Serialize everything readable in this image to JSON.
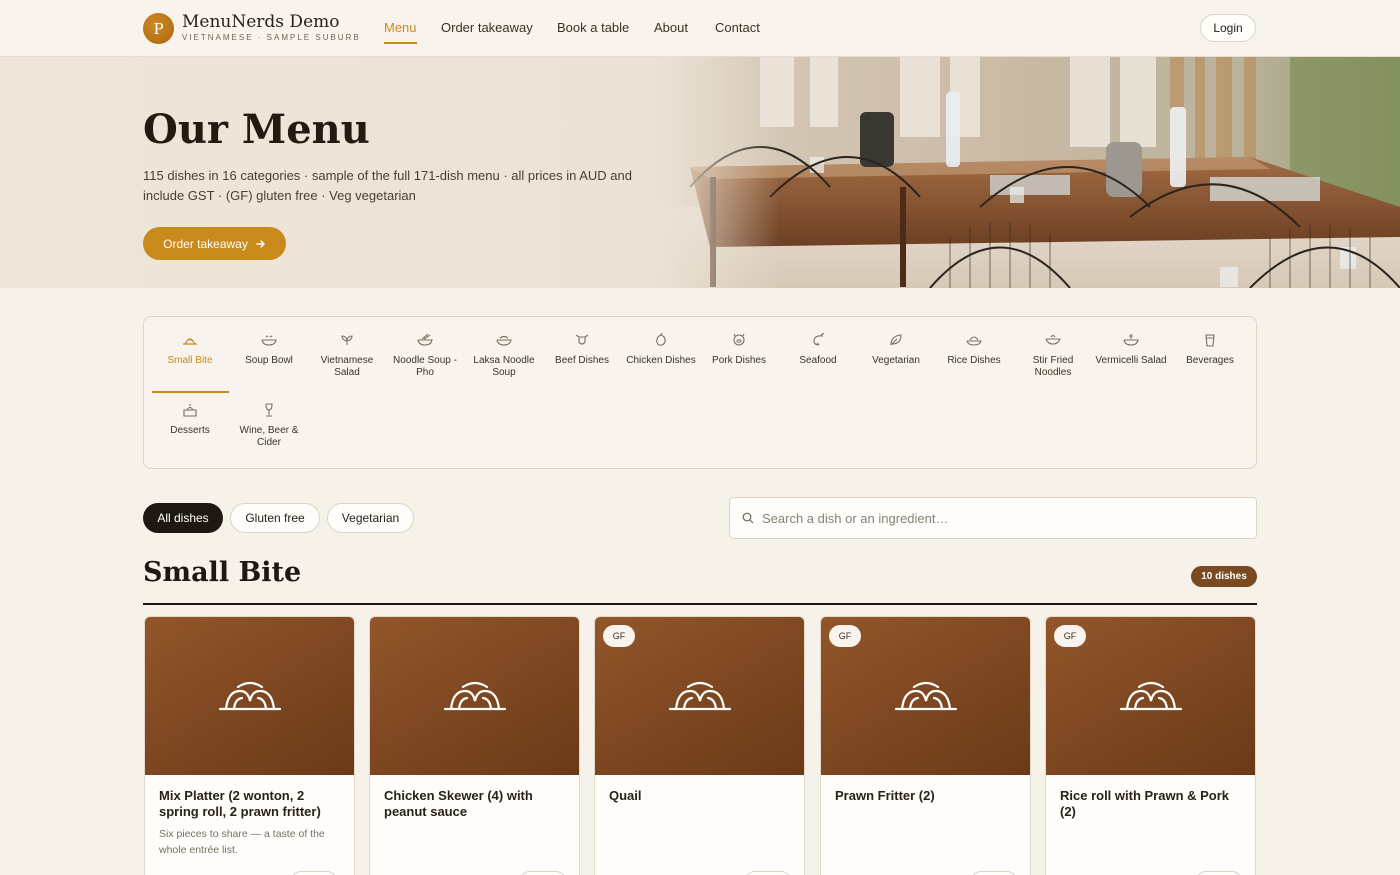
{
  "brand": {
    "logo_letter": "P",
    "name": "MenuNerds Demo",
    "subtitle": "VIETNAMESE · SAMPLE SUBURB"
  },
  "nav": {
    "items": [
      {
        "label": "Menu",
        "active": true
      },
      {
        "label": "Order takeaway"
      },
      {
        "label": "Book a table"
      },
      {
        "label": "About"
      },
      {
        "label": "Contact"
      }
    ],
    "login_label": "Login"
  },
  "hero": {
    "title": "Our Menu",
    "description": "115 dishes in 16 categories · sample of the full 171-dish menu · all prices in AUD and include GST · (GF) gluten free · Veg vegetarian",
    "cta_label": "Order takeaway",
    "cta_icon": "arrow-right-icon"
  },
  "categories": [
    {
      "label": "Small Bite",
      "icon": "platter-icon",
      "active": true
    },
    {
      "label": "Soup Bowl",
      "icon": "bowl-icon"
    },
    {
      "label": "Vietnamese Salad",
      "icon": "leaf-icon"
    },
    {
      "label": "Noodle Soup - Pho",
      "icon": "noodle-bowl-icon"
    },
    {
      "label": "Laksa Noodle Soup",
      "icon": "laksa-bowl-icon"
    },
    {
      "label": "Beef Dishes",
      "icon": "cow-icon"
    },
    {
      "label": "Chicken Dishes",
      "icon": "chicken-icon"
    },
    {
      "label": "Pork Dishes",
      "icon": "pig-icon"
    },
    {
      "label": "Seafood",
      "icon": "shrimp-icon"
    },
    {
      "label": "Vegetarian",
      "icon": "veg-leaf-icon"
    },
    {
      "label": "Rice Dishes",
      "icon": "rice-bowl-icon"
    },
    {
      "label": "Stir Fried Noodles",
      "icon": "wok-icon"
    },
    {
      "label": "Vermicelli Salad",
      "icon": "vermicelli-icon"
    },
    {
      "label": "Beverages",
      "icon": "cup-icon"
    },
    {
      "label": "Desserts",
      "icon": "cake-icon"
    },
    {
      "label": "Wine, Beer & Cider",
      "icon": "wine-glass-icon"
    }
  ],
  "filters": {
    "all": "All dishes",
    "gluten_free": "Gluten free",
    "vegetarian": "Vegetarian"
  },
  "search": {
    "placeholder": "Search a dish or an ingredient…",
    "value": ""
  },
  "section": {
    "title": "Small Bite",
    "count": "10 dishes"
  },
  "dishes": [
    {
      "name": "Mix Platter (2 wonton, 2 spring roll, 2 prawn fritter)",
      "desc": "Six pieces to share — a taste of the whole entrée list.",
      "badge": "",
      "icon": "dish-cloche-icon"
    },
    {
      "name": "Chicken Skewer (4) with peanut sauce",
      "desc": "",
      "badge": "",
      "icon": "dish-cloche-icon"
    },
    {
      "name": "Quail",
      "desc": "",
      "badge": "GF",
      "icon": "dish-cloche-icon"
    },
    {
      "name": "Prawn Fritter (2)",
      "desc": "",
      "badge": "GF",
      "icon": "dish-cloche-icon"
    },
    {
      "name": "Rice roll with Prawn & Pork (2)",
      "desc": "",
      "badge": "GF",
      "icon": "dish-cloche-icon"
    }
  ],
  "colors": {
    "accent": "#c98a1c",
    "dark": "#1f1812",
    "card_image": "#7c4620",
    "badge": "#7a4a22",
    "background": "#f6f1e9"
  }
}
